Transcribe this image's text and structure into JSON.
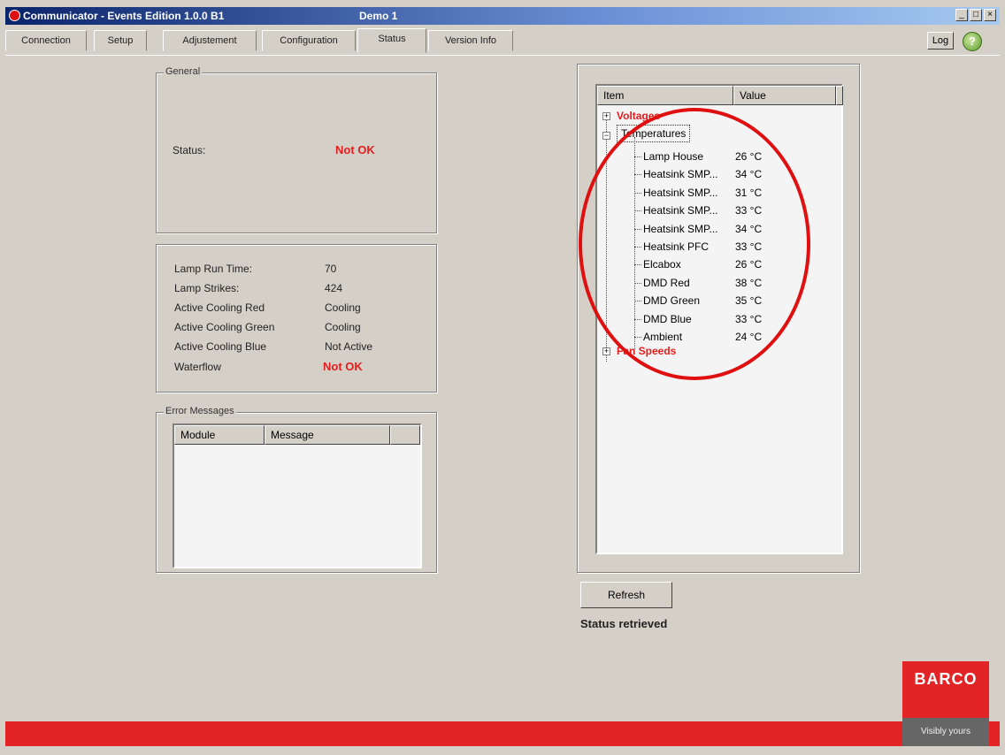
{
  "window": {
    "title": "Communicator - Events Edition 1.0.0 B1",
    "subtitle": "Demo 1",
    "controls": [
      "_",
      "□",
      "×"
    ]
  },
  "tabs": [
    {
      "label": "Connection"
    },
    {
      "label": "Setup"
    },
    {
      "label": "Adjustement"
    },
    {
      "label": "Configuration"
    },
    {
      "label": "Status"
    },
    {
      "label": "Version Info"
    }
  ],
  "toolbar": {
    "log_label": "Log",
    "help_icon": "help-icon"
  },
  "general": {
    "legend": "General",
    "status_label": "Status:",
    "status_value": "Not OK"
  },
  "details": {
    "rows": [
      {
        "label": "Lamp Run Time:",
        "value": "70"
      },
      {
        "label": "Lamp Strikes:",
        "value": "424"
      },
      {
        "label": "Active Cooling Red",
        "value": "Cooling"
      },
      {
        "label": "Active Cooling Green",
        "value": "Cooling"
      },
      {
        "label": "Active Cooling Blue",
        "value": "Not Active"
      },
      {
        "label": "Waterflow",
        "value": "Not OK"
      }
    ]
  },
  "errors": {
    "legend": "Error Messages",
    "columns": [
      "Module",
      "Message"
    ]
  },
  "tree": {
    "columns": [
      "Item",
      "Value"
    ],
    "voltages": "Voltages",
    "temperatures": "Temperatures",
    "fan_speeds": "Fan Speeds",
    "items": [
      {
        "name": "Lamp House",
        "value": "26 °C"
      },
      {
        "name": "Heatsink SMP...",
        "value": "34 °C"
      },
      {
        "name": "Heatsink SMP...",
        "value": "31 °C"
      },
      {
        "name": "Heatsink SMP...",
        "value": "33 °C"
      },
      {
        "name": "Heatsink SMP...",
        "value": "34 °C"
      },
      {
        "name": "Heatsink PFC",
        "value": "33 °C"
      },
      {
        "name": "Elcabox",
        "value": "26 °C"
      },
      {
        "name": "DMD Red",
        "value": "38 °C"
      },
      {
        "name": "DMD Green",
        "value": "35 °C"
      },
      {
        "name": "DMD Blue",
        "value": "33 °C"
      },
      {
        "name": "Ambient",
        "value": "24 °C"
      }
    ]
  },
  "refresh": {
    "label": "Refresh",
    "status": "Status retrieved"
  },
  "brand": {
    "logo": "BARCO",
    "tagline": "Visibly yours",
    "accent": "#e32426"
  }
}
